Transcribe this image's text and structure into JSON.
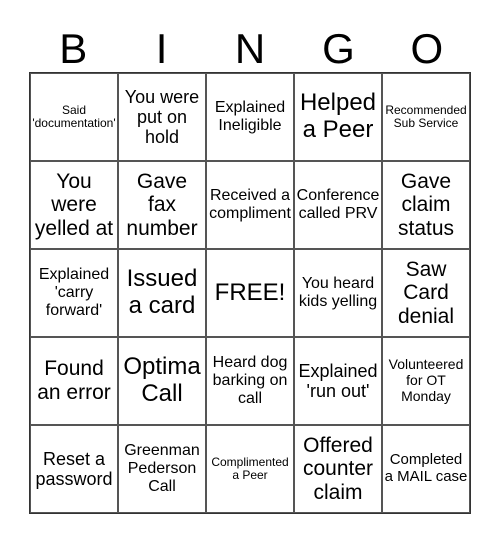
{
  "title_letters": [
    "B",
    "I",
    "N",
    "G",
    "O"
  ],
  "cells": [
    [
      "Said 'documentation'",
      "You were put on hold",
      "Explained Ineligible",
      "Helped a Peer",
      "Recommended Sub Service"
    ],
    [
      "You were yelled at",
      "Gave fax number",
      "Received a compliment",
      "Conference called PRV",
      "Gave claim status"
    ],
    [
      "Explained 'carry forward'",
      "Issued a card",
      "FREE!",
      "You heard kids yelling",
      "Saw Card denial"
    ],
    [
      "Found an error",
      "Optima Call",
      "Heard dog barking on call",
      "Explained 'run out'",
      "Volunteered for OT Monday"
    ],
    [
      "Reset a password",
      "Greenman Pederson Call",
      "Complimented a Peer",
      "Offered counter claim",
      "Completed a MAIL case"
    ]
  ]
}
